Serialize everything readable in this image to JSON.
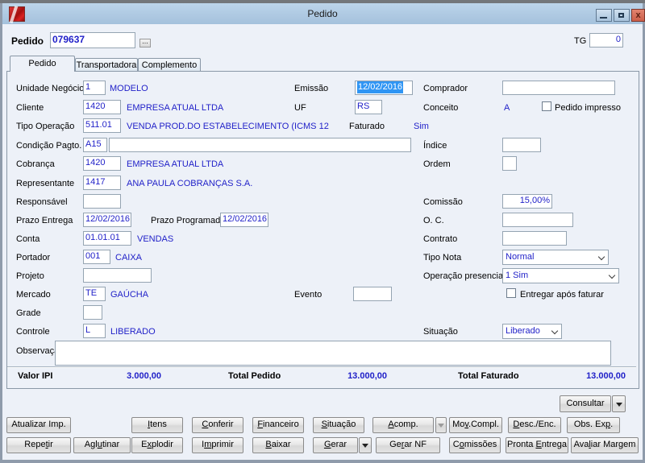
{
  "window": {
    "title": "Pedido",
    "icons": [
      "app-logo-icon",
      "minimize-icon",
      "maximize-icon",
      "close-icon"
    ]
  },
  "header": {
    "pedido_label": "Pedido",
    "pedido_value": "079637",
    "lookup_label": "...",
    "tg_label": "TG",
    "tg_value": "0"
  },
  "tabs": [
    {
      "label": "Pedido",
      "active": true
    },
    {
      "label": "Transportadora",
      "active": false
    },
    {
      "label": "Complemento",
      "active": false
    }
  ],
  "fields": {
    "unidade_negocio": {
      "label": "Unidade Negócio",
      "value": "1",
      "desc": "MODELO"
    },
    "emissao": {
      "label": "Emissão",
      "value": "12/02/2016",
      "selected": true
    },
    "comprador": {
      "label": "Comprador",
      "value": ""
    },
    "cliente": {
      "label": "Cliente",
      "value": "1420",
      "desc": "EMPRESA ATUAL LTDA"
    },
    "uf": {
      "label": "UF",
      "value": "RS"
    },
    "conceito": {
      "label": "Conceito",
      "value": "A"
    },
    "pedido_impresso": {
      "label": "Pedido impresso",
      "checked": false
    },
    "tipo_operacao": {
      "label": "Tipo Operação",
      "value": "511.01",
      "desc": "VENDA PROD.DO ESTABELECIMENTO (ICMS 12"
    },
    "faturado": {
      "label": "Faturado",
      "value": "Sim"
    },
    "condicao_pagto": {
      "label": "Condição Pagto.",
      "value": "A15",
      "desc": ""
    },
    "indice": {
      "label": "Índice",
      "value": ""
    },
    "cobranca": {
      "label": "Cobrança",
      "value": "1420",
      "desc": "EMPRESA ATUAL LTDA"
    },
    "ordem": {
      "label": "Ordem",
      "value": ""
    },
    "representante": {
      "label": "Representante",
      "value": "1417",
      "desc": "ANA PAULA COBRANÇAS S.A."
    },
    "responsavel": {
      "label": "Responsável",
      "value": ""
    },
    "comissao": {
      "label": "Comissão",
      "value": "15,00%"
    },
    "prazo_entrega": {
      "label": "Prazo Entrega",
      "value": "12/02/2016"
    },
    "prazo_programado": {
      "label": "Prazo Programado",
      "value": "12/02/2016"
    },
    "oc": {
      "label": "O. C.",
      "value": ""
    },
    "conta": {
      "label": "Conta",
      "value": "01.01.01",
      "desc": "VENDAS"
    },
    "contrato": {
      "label": "Contrato",
      "value": ""
    },
    "portador": {
      "label": "Portador",
      "value": "001",
      "desc": "CAIXA"
    },
    "tipo_nota": {
      "label": "Tipo Nota",
      "value": "Normal"
    },
    "projeto": {
      "label": "Projeto",
      "value": ""
    },
    "operacao_presencial": {
      "label": "Operação presencial",
      "value": "1 Sim"
    },
    "mercado": {
      "label": "Mercado",
      "value": "TE",
      "desc": "GAÚCHA"
    },
    "evento": {
      "label": "Evento",
      "value": ""
    },
    "entregar_apos_faturar": {
      "label": "Entregar após faturar",
      "checked": false
    },
    "grade": {
      "label": "Grade",
      "value": ""
    },
    "controle": {
      "label": "Controle",
      "value": "L",
      "desc": "LIBERADO"
    },
    "situacao": {
      "label": "Situação",
      "value": "Liberado"
    },
    "observacao": {
      "label": "Observação",
      "value": ""
    }
  },
  "totals": {
    "valor_ipi_label": "Valor IPI",
    "valor_ipi_value": "3.000,00",
    "total_pedido_label": "Total Pedido",
    "total_pedido_value": "13.000,00",
    "total_faturado_label": "Total Faturado",
    "total_faturado_value": "13.000,00"
  },
  "actions": {
    "consultar": {
      "label": "Consultar"
    },
    "row1": [
      {
        "label": "Atualizar Imp.",
        "accel": ""
      },
      {
        "label": "Itens",
        "accel": "I"
      },
      {
        "label": "Conferir",
        "accel": "C"
      },
      {
        "label": "Financeiro",
        "accel": "F"
      },
      {
        "label": "Situação",
        "accel": "S"
      },
      {
        "label": "Acomp.",
        "accel": "A"
      },
      {
        "label": "Mov.Compl.",
        "accel": "v"
      },
      {
        "label": "Desc./Enc.",
        "accel": "D"
      },
      {
        "label": "Obs. Exp.",
        "accel": "p"
      }
    ],
    "row2": [
      {
        "label": "Repetir",
        "accel": "t"
      },
      {
        "label": "Aglutinar",
        "accel": "u"
      },
      {
        "label": "Explodir",
        "accel": "x"
      },
      {
        "label": "Imprimir",
        "accel": "m"
      },
      {
        "label": "Baixar",
        "accel": "B"
      },
      {
        "label": "Gerar",
        "accel": "G"
      },
      {
        "label": "Gerar NF",
        "accel": "r"
      },
      {
        "label": "Comissões",
        "accel": "o"
      },
      {
        "label": "Pronta Entrega",
        "accel": "E"
      },
      {
        "label": "Avaliar Margem",
        "accel": "l"
      }
    ]
  },
  "colors": {
    "value_blue": "#1f1fc8",
    "selection_blue": "#2f95f4",
    "titlebar": "#aecbe5",
    "close_button": "#d9705b",
    "background": "#edf1f8"
  }
}
